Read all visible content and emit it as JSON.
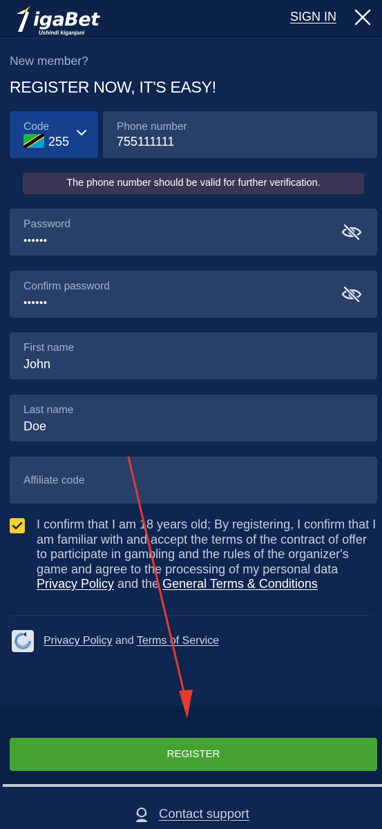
{
  "header": {
    "logo_text": "igaBet",
    "logo_tagline": "Ushindi kiganjani",
    "signin_label": "SIGN IN"
  },
  "intro": {
    "new_member": "New member?",
    "title": "REGISTER NOW, IT'S EASY!"
  },
  "phone": {
    "code_label": "Code",
    "code_value": "255",
    "number_label": "Phone number",
    "number_value": "755111111",
    "verify_message": "The phone number should be valid for further verification."
  },
  "form": {
    "password_label": "Password",
    "password_value": "••••••",
    "confirm_label": "Confirm password",
    "confirm_value": "••••••",
    "first_name_label": "First name",
    "first_name_value": "John",
    "last_name_label": "Last name",
    "last_name_value": "Doe",
    "affiliate_placeholder": "Affiliate code"
  },
  "terms": {
    "checked": true,
    "text": "I confirm that I am 18 years old; By registering, I confirm that I am familiar with and accept the terms of the contract of offer to participate in gambling and the rules of the organizer's game and agree to the processing of my personal data",
    "privacy_link": "Privacy Policy",
    "and_the": "and the",
    "general_terms_link": "General Terms & Conditions"
  },
  "recaptcha": {
    "privacy_link": "Privacy Policy",
    "and": "and",
    "terms_link": "Terms of Service"
  },
  "register_button": "REGISTER",
  "support_link": "Contact support",
  "colors": {
    "background": "#0e2650",
    "field": "#283f68",
    "code_field": "#16408e",
    "register_button": "#46a232",
    "checkbox": "#f6cf2e",
    "arrow": "#e53b2f"
  }
}
